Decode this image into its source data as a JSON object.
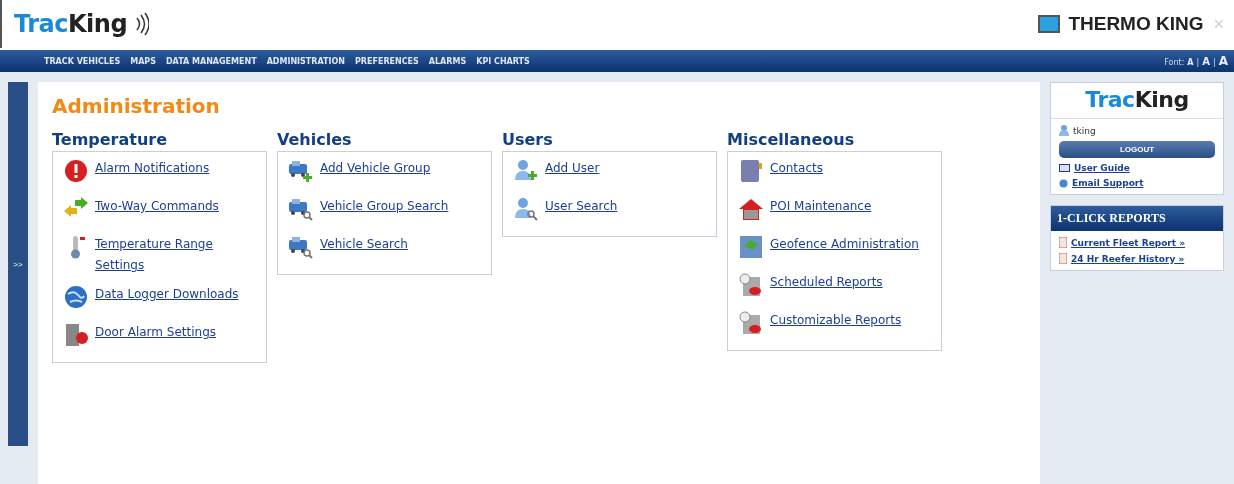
{
  "header": {
    "logo": {
      "part_1": "Trac",
      "part_2": "King"
    },
    "brand": "THERMO KING",
    "close": "×"
  },
  "nav": {
    "items": [
      "TRACK VEHICLES",
      "MAPS",
      "DATA MANAGEMENT",
      "ADMINISTRATION",
      "PREFERENCES",
      "ALARMS",
      "KPI CHARTS"
    ],
    "font_label": "Font:",
    "font_sizes": [
      "A",
      "A",
      "A"
    ],
    "separator": "|"
  },
  "side_toggle": ">>",
  "page_title": "Administration",
  "sections": [
    {
      "title": "Temperature",
      "links": [
        "Alarm Notifications",
        "Two-Way Commands",
        "Temperature Range Settings",
        "Data Logger Downloads",
        "Door Alarm Settings"
      ]
    },
    {
      "title": "Vehicles",
      "links": [
        "Add Vehicle Group",
        "Vehicle Group Search",
        "Vehicle Search"
      ]
    },
    {
      "title": "Users",
      "links": [
        "Add User",
        "User Search"
      ]
    },
    {
      "title": "Miscellaneous",
      "links": [
        "Contacts",
        "POI Maintenance",
        "Geofence Administration",
        "Scheduled Reports",
        "Customizable Reports"
      ]
    }
  ],
  "account": {
    "logo": {
      "part_1": "Trac",
      "part_2": "King"
    },
    "username": "tking",
    "logout": "LOGOUT",
    "links": [
      "User Guide",
      "Email Support"
    ]
  },
  "reports": {
    "title": "1-CLICK REPORTS",
    "links": [
      "Current Fleet Report »",
      "24 Hr Reefer History »"
    ]
  }
}
